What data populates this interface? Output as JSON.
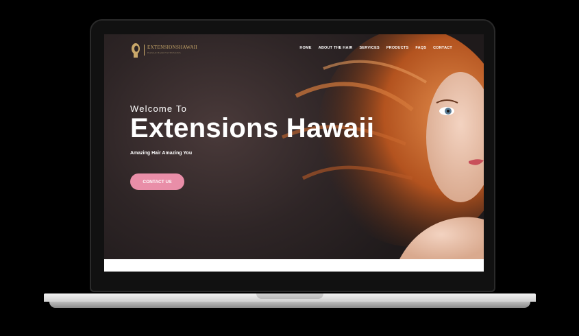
{
  "brand": {
    "logo_text": "EXTENSIONSHAWAII",
    "logo_sub": "HAWAII HAIR EXTENSIONS"
  },
  "nav": {
    "items": [
      "HOME",
      "ABOUT THE HAIR",
      "SERVICES",
      "PRODUCTS",
      "FAQS",
      "CONTACT"
    ]
  },
  "hero": {
    "welcome": "Welcome To",
    "title": "Extensions Hawaii",
    "tagline": "Amazing Hair Amazing You",
    "cta_label": "CONTACT US"
  },
  "colors": {
    "accent": "#e98ea8",
    "logo_gold": "#c9a86a",
    "hero_bg": "#2b2325",
    "hair": "#c4622d"
  }
}
